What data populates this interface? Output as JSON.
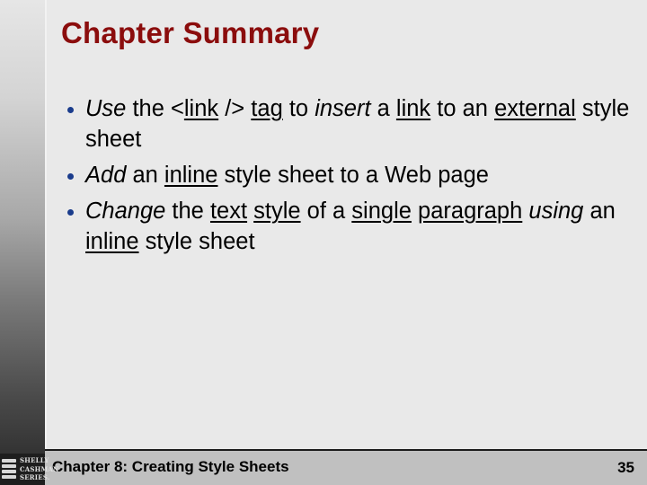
{
  "slide": {
    "title": "Chapter Summary",
    "title_color": "#8b0d0d",
    "bullet_color": "#1a3c8c",
    "bullets": [
      {
        "segments": [
          {
            "text": "Use",
            "style": "italic"
          },
          {
            "text": " the <",
            "style": "normal"
          },
          {
            "text": "link",
            "style": "underline"
          },
          {
            "text": " /> ",
            "style": "normal"
          },
          {
            "text": "tag",
            "style": "underline"
          },
          {
            "text": " to ",
            "style": "normal"
          },
          {
            "text": "insert",
            "style": "italic"
          },
          {
            "text": " a ",
            "style": "normal"
          },
          {
            "text": "link",
            "style": "underline"
          },
          {
            "text": " to an ",
            "style": "normal"
          },
          {
            "text": "external",
            "style": "underline"
          },
          {
            "text": " style sheet",
            "style": "normal"
          }
        ]
      },
      {
        "segments": [
          {
            "text": "Add",
            "style": "italic"
          },
          {
            "text": " an ",
            "style": "normal"
          },
          {
            "text": "inline",
            "style": "underline"
          },
          {
            "text": " style sheet to a Web page",
            "style": "normal"
          }
        ]
      },
      {
        "segments": [
          {
            "text": "Change",
            "style": "italic"
          },
          {
            "text": " the ",
            "style": "normal"
          },
          {
            "text": "text",
            "style": "underline"
          },
          {
            "text": " ",
            "style": "normal"
          },
          {
            "text": "style",
            "style": "underline"
          },
          {
            "text": " of a ",
            "style": "normal"
          },
          {
            "text": "single",
            "style": "underline"
          },
          {
            "text": " ",
            "style": "normal"
          },
          {
            "text": "paragraph",
            "style": "underline"
          },
          {
            "text": " ",
            "style": "normal"
          },
          {
            "text": "using",
            "style": "italic"
          },
          {
            "text": " an ",
            "style": "normal"
          },
          {
            "text": "inline",
            "style": "underline"
          },
          {
            "text": " style sheet",
            "style": "normal"
          }
        ]
      }
    ]
  },
  "footer": {
    "chapter_label": "Chapter 8: Creating Style Sheets",
    "page_number": "35"
  },
  "logo": {
    "icon": "stacked-books-icon",
    "lines": [
      "SHELLY",
      "CASHMAN",
      "SERIES."
    ]
  }
}
